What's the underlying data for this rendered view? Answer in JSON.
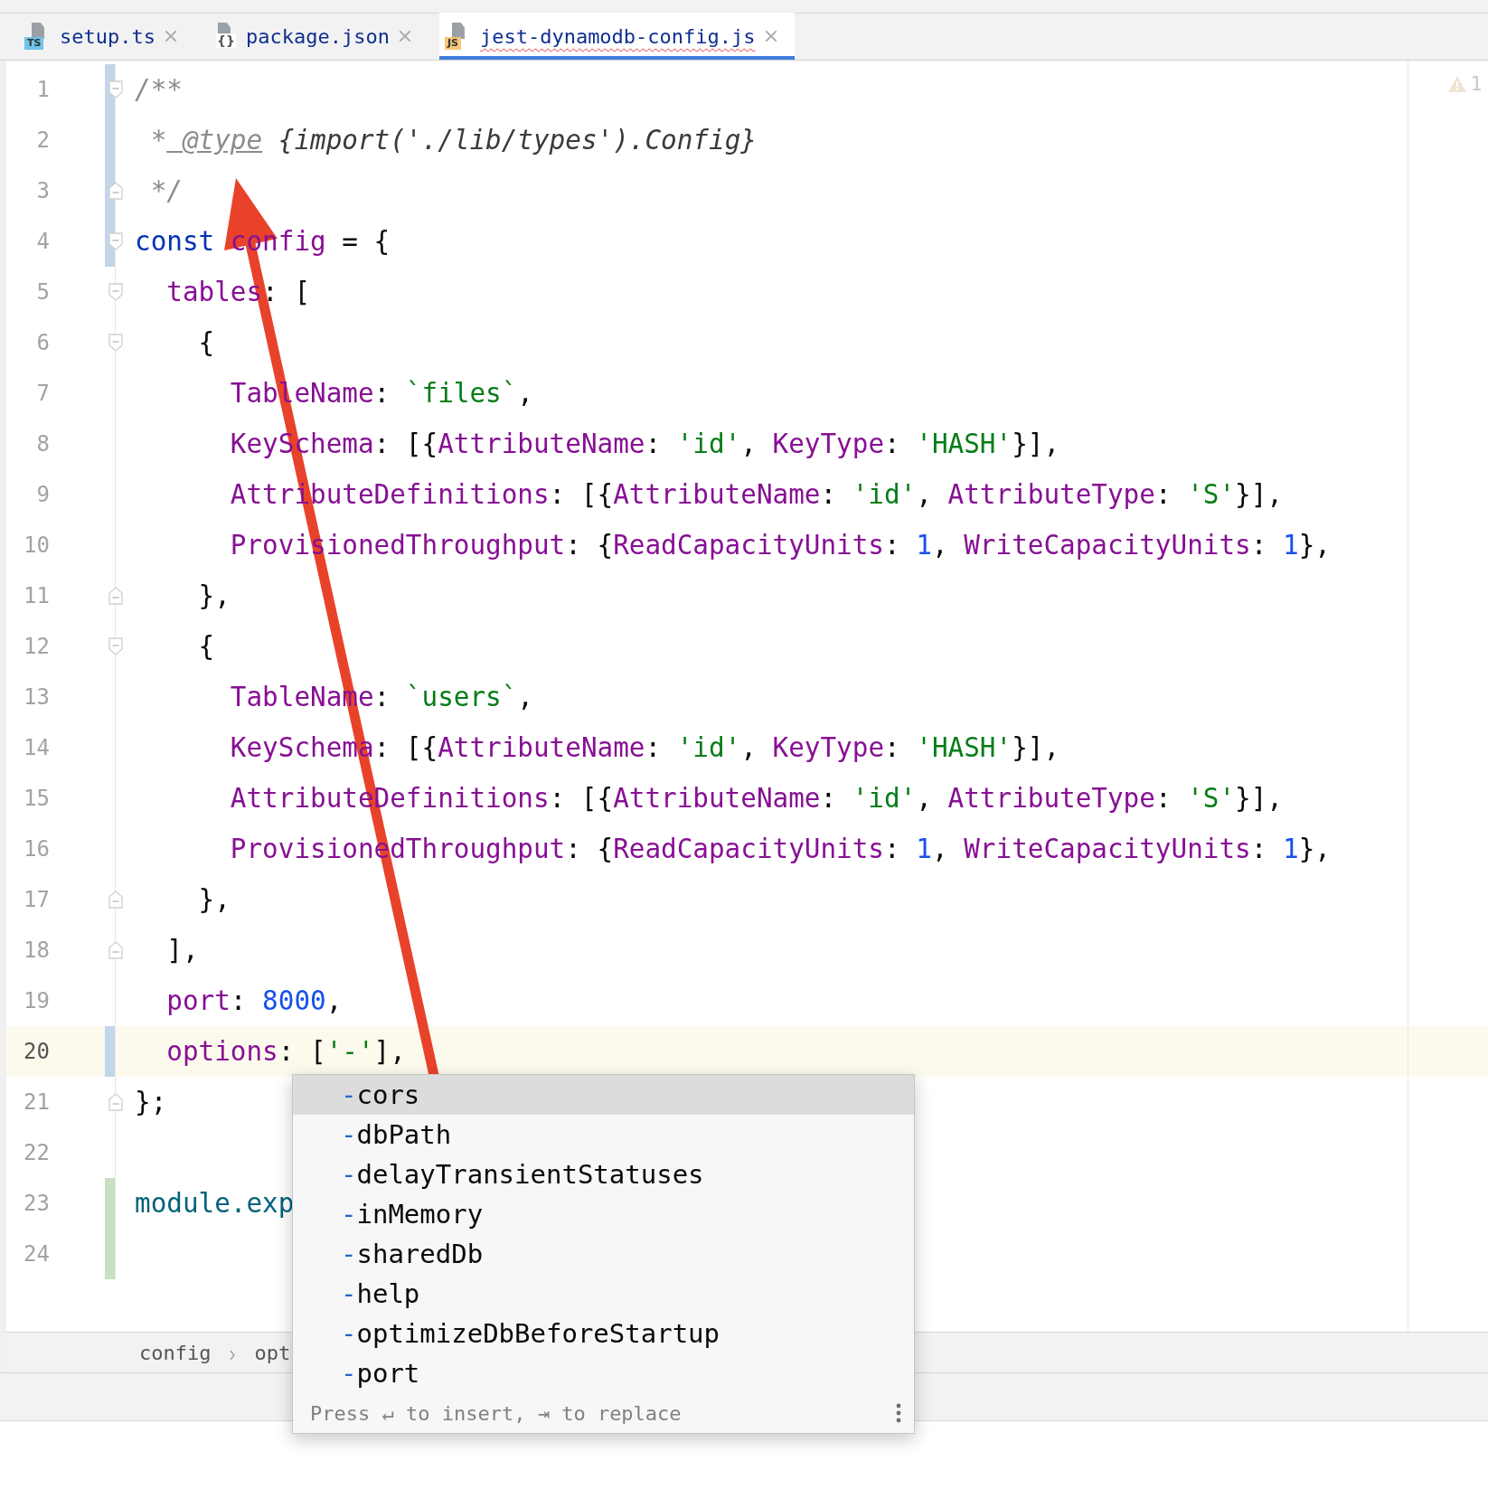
{
  "tabs": [
    {
      "kind": "ts",
      "icon_label": "TS",
      "label": "setup.ts",
      "selected": false,
      "error": false
    },
    {
      "kind": "json",
      "icon_label": "{}",
      "label": "package.json",
      "selected": false,
      "error": false
    },
    {
      "kind": "js",
      "icon_label": "JS",
      "label": "jest-dynamodb-config.js",
      "selected": true,
      "error": true
    }
  ],
  "editor": {
    "inspections": {
      "warnings": "1"
    },
    "lines": [
      {
        "number": "1",
        "modified": true,
        "added": false,
        "fold_start": true,
        "fold_end": false,
        "current": false,
        "tokens": [
          {
            "kind": "comment",
            "text": "/**"
          }
        ]
      },
      {
        "number": "2",
        "modified": true,
        "added": false,
        "fold_start": false,
        "fold_end": false,
        "current": false,
        "tokens": [
          {
            "kind": "comment",
            "text": " *"
          },
          {
            "kind": "doctag",
            "text": " @type"
          },
          {
            "kind": "doctext",
            "text": " {import('./lib/types').Config}"
          }
        ]
      },
      {
        "number": "3",
        "modified": true,
        "added": false,
        "fold_start": false,
        "fold_end": true,
        "current": false,
        "tokens": [
          {
            "kind": "comment",
            "text": " */"
          }
        ]
      },
      {
        "number": "4",
        "modified": true,
        "added": false,
        "fold_start": true,
        "fold_end": false,
        "current": false,
        "tokens": [
          {
            "kind": "keyword",
            "text": "const"
          },
          {
            "kind": "property",
            "text": " config"
          },
          {
            "kind": "plain",
            "text": " = {"
          }
        ]
      },
      {
        "number": "5",
        "modified": false,
        "added": false,
        "fold_start": true,
        "fold_end": false,
        "current": false,
        "tokens": [
          {
            "kind": "property",
            "text": "  tables"
          },
          {
            "kind": "plain",
            "text": ": ["
          }
        ]
      },
      {
        "number": "6",
        "modified": false,
        "added": false,
        "fold_start": true,
        "fold_end": false,
        "current": false,
        "tokens": [
          {
            "kind": "plain",
            "text": "    {"
          }
        ]
      },
      {
        "number": "7",
        "modified": false,
        "added": false,
        "fold_start": false,
        "fold_end": false,
        "current": false,
        "tokens": [
          {
            "kind": "property",
            "text": "      TableName"
          },
          {
            "kind": "plain",
            "text": ":"
          },
          {
            "kind": "string",
            "text": " `files`"
          },
          {
            "kind": "plain",
            "text": ","
          }
        ]
      },
      {
        "number": "8",
        "modified": false,
        "added": false,
        "fold_start": false,
        "fold_end": false,
        "current": false,
        "tokens": [
          {
            "kind": "property",
            "text": "      KeySchema"
          },
          {
            "kind": "plain",
            "text": ": [{"
          },
          {
            "kind": "property",
            "text": "AttributeName"
          },
          {
            "kind": "plain",
            "text": ":"
          },
          {
            "kind": "string",
            "text": " 'id'"
          },
          {
            "kind": "plain",
            "text": ","
          },
          {
            "kind": "property",
            "text": " KeyType"
          },
          {
            "kind": "plain",
            "text": ":"
          },
          {
            "kind": "string",
            "text": " 'HASH'"
          },
          {
            "kind": "plain",
            "text": "}],"
          }
        ]
      },
      {
        "number": "9",
        "modified": false,
        "added": false,
        "fold_start": false,
        "fold_end": false,
        "current": false,
        "tokens": [
          {
            "kind": "property",
            "text": "      AttributeDefinitions"
          },
          {
            "kind": "plain",
            "text": ": [{"
          },
          {
            "kind": "property",
            "text": "AttributeName"
          },
          {
            "kind": "plain",
            "text": ":"
          },
          {
            "kind": "string",
            "text": " 'id'"
          },
          {
            "kind": "plain",
            "text": ","
          },
          {
            "kind": "property",
            "text": " AttributeType"
          },
          {
            "kind": "plain",
            "text": ":"
          },
          {
            "kind": "string",
            "text": " 'S'"
          },
          {
            "kind": "plain",
            "text": "}],"
          }
        ]
      },
      {
        "number": "10",
        "modified": false,
        "added": false,
        "fold_start": false,
        "fold_end": false,
        "current": false,
        "tokens": [
          {
            "kind": "property",
            "text": "      ProvisionedThroughput"
          },
          {
            "kind": "plain",
            "text": ": {"
          },
          {
            "kind": "property",
            "text": "ReadCapacityUnits"
          },
          {
            "kind": "plain",
            "text": ":"
          },
          {
            "kind": "number",
            "text": " 1"
          },
          {
            "kind": "plain",
            "text": ","
          },
          {
            "kind": "property",
            "text": " WriteCapacityUnits"
          },
          {
            "kind": "plain",
            "text": ":"
          },
          {
            "kind": "number",
            "text": " 1"
          },
          {
            "kind": "plain",
            "text": "},"
          }
        ]
      },
      {
        "number": "11",
        "modified": false,
        "added": false,
        "fold_start": false,
        "fold_end": true,
        "current": false,
        "tokens": [
          {
            "kind": "plain",
            "text": "    },"
          }
        ]
      },
      {
        "number": "12",
        "modified": false,
        "added": false,
        "fold_start": true,
        "fold_end": false,
        "current": false,
        "tokens": [
          {
            "kind": "plain",
            "text": "    {"
          }
        ]
      },
      {
        "number": "13",
        "modified": false,
        "added": false,
        "fold_start": false,
        "fold_end": false,
        "current": false,
        "tokens": [
          {
            "kind": "property",
            "text": "      TableName"
          },
          {
            "kind": "plain",
            "text": ":"
          },
          {
            "kind": "string",
            "text": " `users`"
          },
          {
            "kind": "plain",
            "text": ","
          }
        ]
      },
      {
        "number": "14",
        "modified": false,
        "added": false,
        "fold_start": false,
        "fold_end": false,
        "current": false,
        "tokens": [
          {
            "kind": "property",
            "text": "      KeySchema"
          },
          {
            "kind": "plain",
            "text": ": [{"
          },
          {
            "kind": "property",
            "text": "AttributeName"
          },
          {
            "kind": "plain",
            "text": ":"
          },
          {
            "kind": "string",
            "text": " 'id'"
          },
          {
            "kind": "plain",
            "text": ","
          },
          {
            "kind": "property",
            "text": " KeyType"
          },
          {
            "kind": "plain",
            "text": ":"
          },
          {
            "kind": "string",
            "text": " 'HASH'"
          },
          {
            "kind": "plain",
            "text": "}],"
          }
        ]
      },
      {
        "number": "15",
        "modified": false,
        "added": false,
        "fold_start": false,
        "fold_end": false,
        "current": false,
        "tokens": [
          {
            "kind": "property",
            "text": "      AttributeDefinitions"
          },
          {
            "kind": "plain",
            "text": ": [{"
          },
          {
            "kind": "property",
            "text": "AttributeName"
          },
          {
            "kind": "plain",
            "text": ":"
          },
          {
            "kind": "string",
            "text": " 'id'"
          },
          {
            "kind": "plain",
            "text": ","
          },
          {
            "kind": "property",
            "text": " AttributeType"
          },
          {
            "kind": "plain",
            "text": ":"
          },
          {
            "kind": "string",
            "text": " 'S'"
          },
          {
            "kind": "plain",
            "text": "}],"
          }
        ]
      },
      {
        "number": "16",
        "modified": false,
        "added": false,
        "fold_start": false,
        "fold_end": false,
        "current": false,
        "tokens": [
          {
            "kind": "property",
            "text": "      ProvisionedThroughput"
          },
          {
            "kind": "plain",
            "text": ": {"
          },
          {
            "kind": "property",
            "text": "ReadCapacityUnits"
          },
          {
            "kind": "plain",
            "text": ":"
          },
          {
            "kind": "number",
            "text": " 1"
          },
          {
            "kind": "plain",
            "text": ","
          },
          {
            "kind": "property",
            "text": " WriteCapacityUnits"
          },
          {
            "kind": "plain",
            "text": ":"
          },
          {
            "kind": "number",
            "text": " 1"
          },
          {
            "kind": "plain",
            "text": "},"
          }
        ]
      },
      {
        "number": "17",
        "modified": false,
        "added": false,
        "fold_start": false,
        "fold_end": true,
        "current": false,
        "tokens": [
          {
            "kind": "plain",
            "text": "    },"
          }
        ]
      },
      {
        "number": "18",
        "modified": false,
        "added": false,
        "fold_start": false,
        "fold_end": true,
        "current": false,
        "tokens": [
          {
            "kind": "plain",
            "text": "  ],"
          }
        ]
      },
      {
        "number": "19",
        "modified": false,
        "added": false,
        "fold_start": false,
        "fold_end": false,
        "current": false,
        "tokens": [
          {
            "kind": "property",
            "text": "  port"
          },
          {
            "kind": "plain",
            "text": ":"
          },
          {
            "kind": "number",
            "text": " 8000"
          },
          {
            "kind": "plain",
            "text": ","
          }
        ]
      },
      {
        "number": "20",
        "modified": true,
        "added": false,
        "fold_start": false,
        "fold_end": false,
        "current": true,
        "tokens": [
          {
            "kind": "property",
            "text": "  options"
          },
          {
            "kind": "plain",
            "text": ": ["
          },
          {
            "kind": "string",
            "text": "'-'"
          },
          {
            "kind": "plain",
            "text": "],"
          }
        ]
      },
      {
        "number": "21",
        "modified": false,
        "added": false,
        "fold_start": false,
        "fold_end": true,
        "current": false,
        "tokens": [
          {
            "kind": "plain",
            "text": "};"
          }
        ]
      },
      {
        "number": "22",
        "modified": false,
        "added": false,
        "fold_start": false,
        "fold_end": false,
        "current": false
      },
      {
        "number": "23",
        "modified": false,
        "added": true,
        "fold_start": false,
        "fold_end": false,
        "current": false,
        "tokens": [
          {
            "kind": "module",
            "text": "module.exp"
          }
        ]
      },
      {
        "number": "24",
        "modified": false,
        "added": true,
        "fold_start": false,
        "fold_end": false,
        "current": false
      }
    ]
  },
  "breadcrumbs": [
    "config",
    "opt"
  ],
  "completion": {
    "items": [
      {
        "prefix": "-",
        "label": "cors",
        "selected": true
      },
      {
        "prefix": "-",
        "label": "dbPath",
        "selected": false
      },
      {
        "prefix": "-",
        "label": "delayTransientStatuses",
        "selected": false
      },
      {
        "prefix": "-",
        "label": "inMemory",
        "selected": false
      },
      {
        "prefix": "-",
        "label": "sharedDb",
        "selected": false
      },
      {
        "prefix": "-",
        "label": "help",
        "selected": false
      },
      {
        "prefix": "-",
        "label": "optimizeDbBeforeStartup",
        "selected": false
      },
      {
        "prefix": "-",
        "label": "port",
        "selected": false
      }
    ],
    "hint": "Press ↵ to insert, ⇥ to replace"
  }
}
